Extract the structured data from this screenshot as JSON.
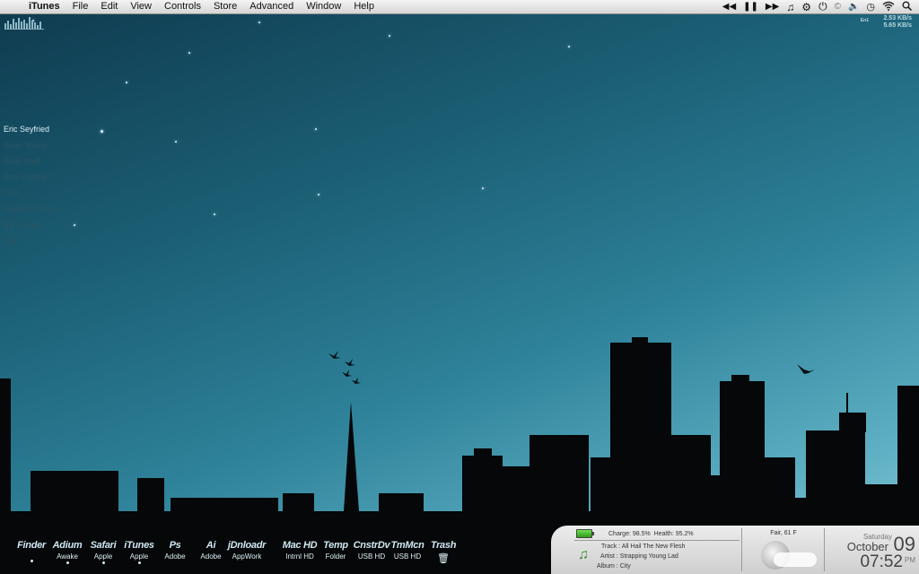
{
  "menubar": {
    "app_name": "iTunes",
    "menus": [
      "File",
      "Edit",
      "View",
      "Controls",
      "Store",
      "Advanced",
      "Window",
      "Help"
    ],
    "extras": [
      "rewind-icon",
      "pause-icon",
      "fast-forward-icon",
      "music-note-icon",
      "gear-icon",
      "power-icon",
      "copyright-icon",
      "volume-icon",
      "time-machine-icon",
      "wifi-icon",
      "spotlight-icon"
    ]
  },
  "network": {
    "label": "En1",
    "upload": "2.53 KB/s",
    "download": "5.65 KB/s"
  },
  "contacts": [
    "Eric Seyfried",
    "Sean Young",
    "Keith Wolf",
    "Jess Hattey",
    "Dad",
    "Hannah Dennis",
    "Bill Connor",
    "Dad"
  ],
  "dock": [
    {
      "name": "Finder",
      "sub": ""
    },
    {
      "name": "Adium",
      "sub": "Awake"
    },
    {
      "name": "Safari",
      "sub": "Apple"
    },
    {
      "name": "iTunes",
      "sub": "Apple"
    },
    {
      "name": "Ps",
      "sub": "Adobe"
    },
    {
      "name": "Ai",
      "sub": "Adobe"
    },
    {
      "name": "jDnloadr",
      "sub": "AppWork"
    },
    {
      "name": "Mac HD",
      "sub": "Intrnl HD"
    },
    {
      "name": "Temp",
      "sub": "Folder"
    },
    {
      "name": "CnstrDv",
      "sub": "USB HD"
    },
    {
      "name": "TmMcn",
      "sub": "USB HD"
    },
    {
      "name": "Trash",
      "sub": ""
    }
  ],
  "battery": {
    "charge": "Charge: 98.5%",
    "health": "Health: 95.2%",
    "level": 0.985
  },
  "now_playing": {
    "track_label": "Track :",
    "track": "All Hail The New Flesh",
    "artist_label": "Artist :",
    "artist": "Strapping Young Lad",
    "album_label": "Album :",
    "album": "City"
  },
  "weather": {
    "condition": "Fair, 61 F"
  },
  "clock": {
    "weekday": "Saturday",
    "month": "October",
    "day": "09",
    "time": "07:52",
    "ampm": "PM"
  }
}
